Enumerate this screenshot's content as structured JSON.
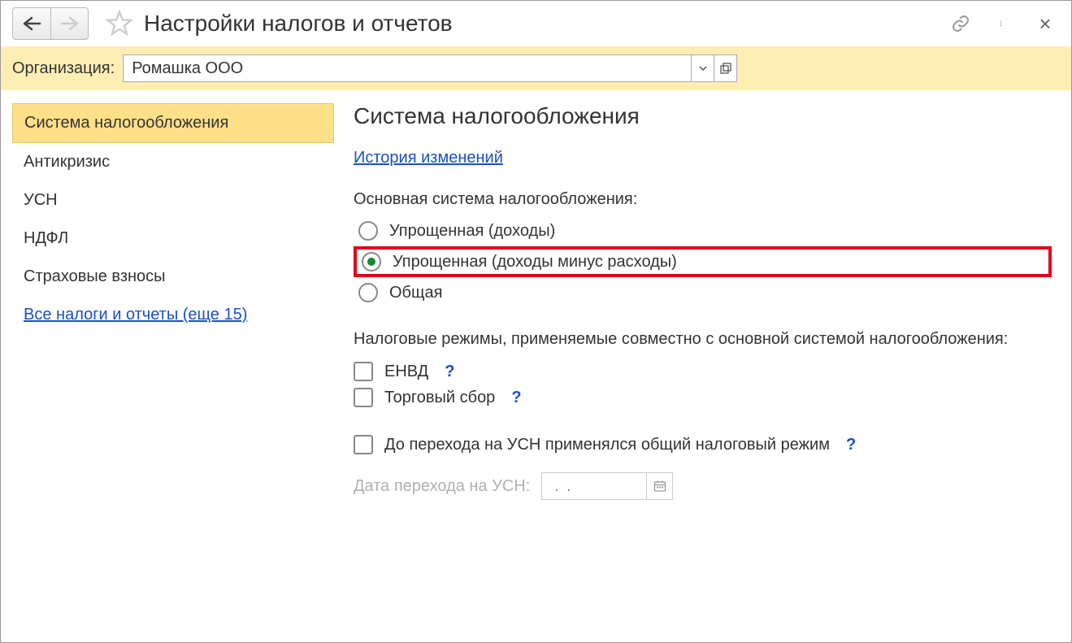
{
  "title": "Настройки налогов и отчетов",
  "org": {
    "label": "Организация:",
    "value": "Ромашка ООО"
  },
  "sidebar": {
    "items": [
      "Система налогообложения",
      "Антикризис",
      "УСН",
      "НДФЛ",
      "Страховые взносы"
    ],
    "more_link": "Все налоги и отчеты (еще 15)"
  },
  "content": {
    "heading": "Система налогообложения",
    "history_link": "История изменений",
    "main_label": "Основная система налогообложения:",
    "radios": [
      "Упрощенная (доходы)",
      "Упрощенная (доходы минус расходы)",
      "Общая"
    ],
    "regimes_label": "Налоговые режимы, применяемые совместно с основной системой налогообложения:",
    "checks": [
      "ЕНВД",
      "Торговый сбор"
    ],
    "prior_check": "До перехода на УСН применялся общий налоговый режим",
    "date_label": "Дата перехода на УСН:",
    "date_placeholder": " .  .    ",
    "help": "?"
  }
}
